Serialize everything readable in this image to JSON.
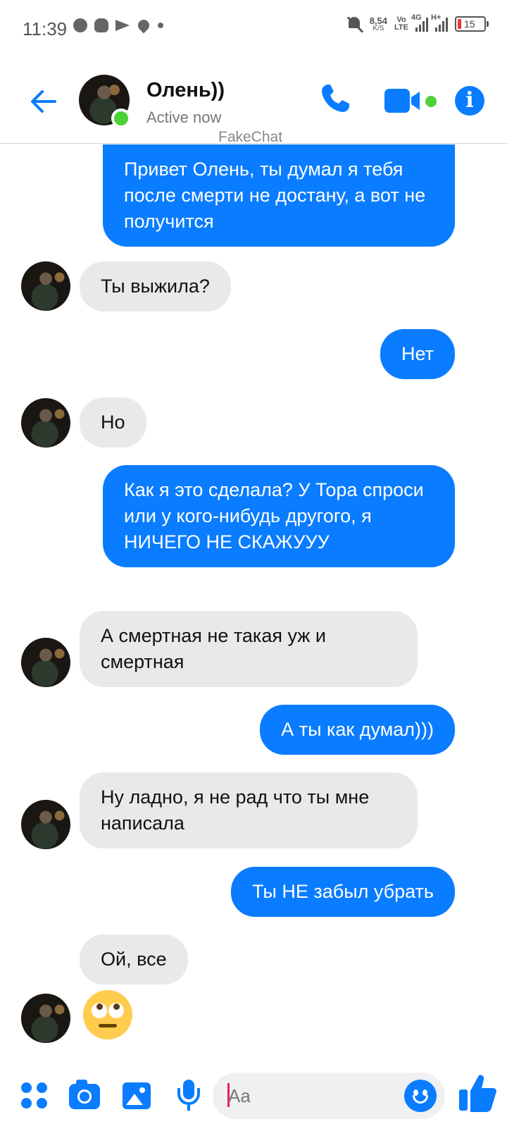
{
  "status_bar": {
    "time": "11:39",
    "net_speed_value": "8,54",
    "net_speed_unit": "K/S",
    "volte_top": "Vo",
    "volte_bottom": "LTE",
    "sim1_label": "4G",
    "sim2_label": "H+",
    "battery": "15"
  },
  "header": {
    "name": "Олень))",
    "status": "Active now",
    "watermark": "FakeChat"
  },
  "colors": {
    "accent": "#0a7cff",
    "incoming_bubble": "#e9e9eb",
    "online": "#4cd137",
    "battery_low": "#e53935"
  },
  "messages": [
    {
      "dir": "out",
      "text": "Привет Олень, ты думал я тебя после смерти не достану, а вот не получится"
    },
    {
      "dir": "in",
      "text": "Ты выжила?"
    },
    {
      "dir": "out",
      "text": "Нет"
    },
    {
      "dir": "in",
      "text": "Но"
    },
    {
      "dir": "out",
      "text": "Как я это сделала? У Тора спроси или у кого-нибудь другого, я НИЧЕГО НЕ СКАЖУУУ"
    },
    {
      "dir": "in",
      "text": "А смертная не такая уж и смертная"
    },
    {
      "dir": "out",
      "text": "А ты как думал)))"
    },
    {
      "dir": "in",
      "text": "Ну ладно, я не рад что ты мне написала"
    },
    {
      "dir": "out",
      "text": "Ты НЕ забыл убрать"
    },
    {
      "dir": "in",
      "text": "Ой, все"
    },
    {
      "dir": "in",
      "emoji": "face-with-rolling-eyes"
    }
  ],
  "composer": {
    "placeholder": "Aa"
  },
  "icons": {
    "back": "arrow-left-icon",
    "call": "phone-icon",
    "video": "video-camera-icon",
    "info": "info-icon",
    "apps": "apps-grid-icon",
    "camera": "camera-icon",
    "gallery": "image-icon",
    "mic": "microphone-icon",
    "emoji": "smile-icon",
    "like": "thumbs-up-icon"
  }
}
